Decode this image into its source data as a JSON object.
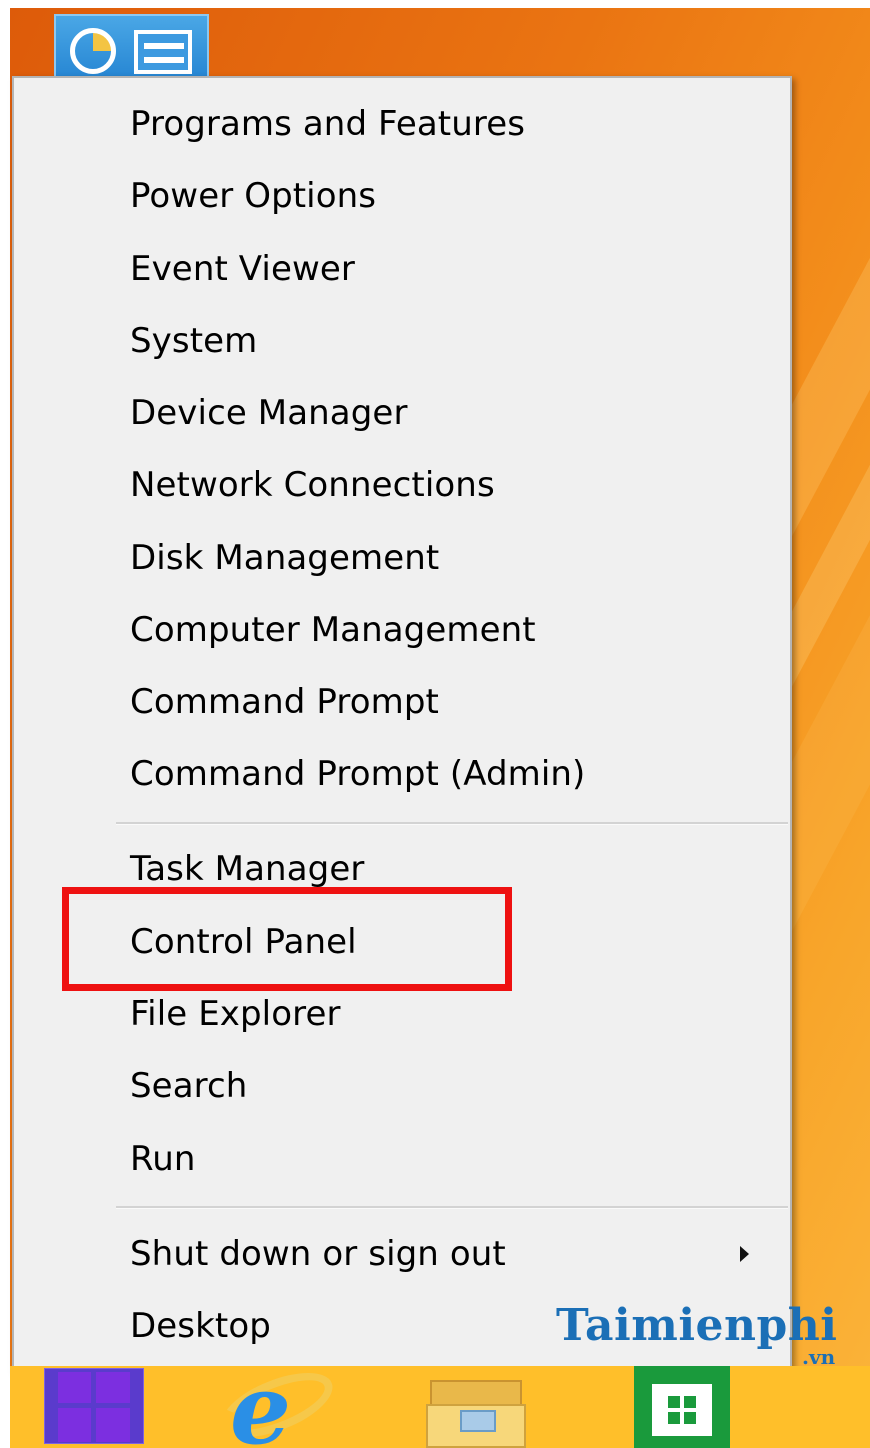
{
  "desktop": {
    "accent_color": "#eb7614",
    "top_icon": "control-panel-tile-icon"
  },
  "menu": {
    "groups": [
      {
        "items": [
          {
            "label": "Programs and Features"
          },
          {
            "label": "Power Options"
          },
          {
            "label": "Event Viewer"
          },
          {
            "label": "System"
          },
          {
            "label": "Device Manager"
          },
          {
            "label": "Network Connections"
          },
          {
            "label": "Disk Management"
          },
          {
            "label": "Computer Management"
          },
          {
            "label": "Command Prompt"
          },
          {
            "label": "Command Prompt (Admin)"
          }
        ]
      },
      {
        "items": [
          {
            "label": "Task Manager"
          },
          {
            "label": "Control Panel",
            "highlighted": true
          },
          {
            "label": "File Explorer"
          },
          {
            "label": "Search"
          },
          {
            "label": "Run"
          }
        ]
      },
      {
        "items": [
          {
            "label": "Shut down or sign out",
            "has_submenu": true
          },
          {
            "label": "Desktop"
          }
        ]
      }
    ],
    "highlight_color": "#ee1111"
  },
  "taskbar": {
    "background_color": "#ffbf2a",
    "icons": [
      "windows-start-icon",
      "internet-explorer-icon",
      "file-explorer-icon",
      "windows-store-icon"
    ]
  },
  "watermark": {
    "brand": "Taimienphi",
    "tld": ".vn"
  }
}
